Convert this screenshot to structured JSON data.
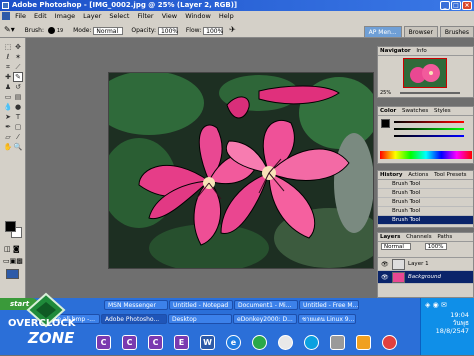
{
  "window": {
    "title": "Adobe Photoshop - [IMG_0002.jpg @ 25% (Layer 2, RGB)]",
    "min": "_",
    "max": "□",
    "close": "×"
  },
  "menu": [
    "File",
    "Edit",
    "Image",
    "Layer",
    "Select",
    "Filter",
    "View",
    "Window",
    "Help"
  ],
  "options": {
    "tool_label": "Brush:",
    "brush_size": "19",
    "mode_label": "Mode:",
    "mode_value": "Normal",
    "opacity_label": "Opacity:",
    "opacity_value": "100%",
    "flow_label": "Flow:",
    "flow_value": "100%",
    "ap_tab": "AP Men...",
    "browser_tab": "Browser",
    "brushes_tab": "Brushes"
  },
  "colors": {
    "foreground": "#000000",
    "background": "#ffffff"
  },
  "panels": {
    "navigator": {
      "tabs": [
        "Navigator",
        "Info"
      ]
    },
    "zoom": "25%",
    "color": {
      "tabs": [
        "Color",
        "Swatches",
        "Styles"
      ]
    },
    "history": {
      "tabs": [
        "History",
        "Actions",
        "Tool Presets"
      ],
      "items": [
        "Brush Tool",
        "Brush Tool",
        "Brush Tool",
        "Brush Tool",
        "Brush Tool"
      ]
    },
    "layers": {
      "tabs": [
        "Layers",
        "Channels",
        "Paths"
      ],
      "blend": "Normal",
      "opacity": "100%",
      "rows": [
        "Layer 1",
        "Background"
      ]
    }
  },
  "taskbar": {
    "start": "start",
    "row1": [
      "MSN Messenger",
      "Untitled - Notepad",
      "Document1 - Mi...",
      "Untitled - Free M..."
    ],
    "row2": [
      "delete all.bmp -...",
      "Adobe Photosho...",
      "Desktop",
      "eDonkey2000: D...",
      "ชายแดน Linux 9..."
    ],
    "clock_time": "19:04",
    "clock_day": "วันพุธ",
    "clock_date": "18/8/2547",
    "quicklaunch": [
      "C",
      "C",
      "C",
      "E",
      "W",
      "e"
    ]
  },
  "brand": {
    "line1": "OVERCLOCK",
    "line2": "ZONE"
  }
}
